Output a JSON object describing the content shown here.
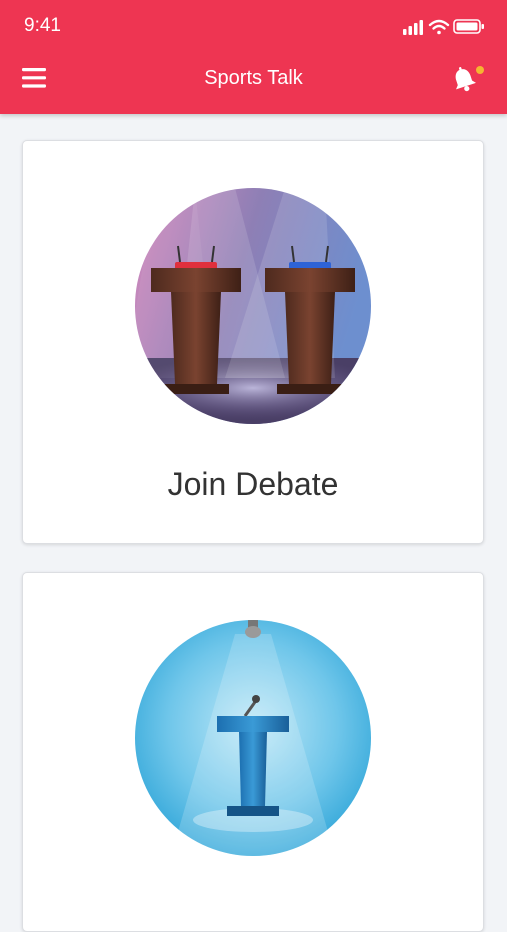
{
  "status_bar": {
    "time": "9:41",
    "icons": [
      "signal-icon",
      "wifi-icon",
      "battery-icon"
    ]
  },
  "app_bar": {
    "title": "Sports Talk",
    "menu_icon": "hamburger-menu-icon",
    "notification_icon": "bell-icon",
    "notification_badge_color": "#f5b531"
  },
  "colors": {
    "accent": "#ee3552",
    "background": "#f2f4f7",
    "card": "#ffffff"
  },
  "cards": [
    {
      "label": "Join Debate",
      "image": "debate-podiums-illustration"
    },
    {
      "label": "",
      "image": "speaker-podium-illustration"
    }
  ]
}
